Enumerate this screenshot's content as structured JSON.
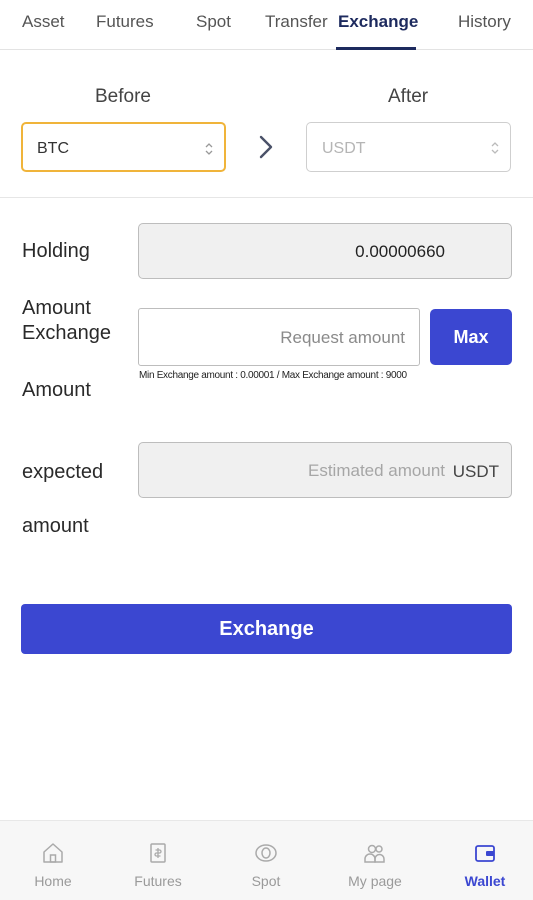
{
  "top_tabs": {
    "asset": "Asset",
    "futures": "Futures",
    "spot": "Spot",
    "transfer": "Transfer",
    "exchange": "Exchange",
    "history": "History",
    "active": "Exchange"
  },
  "swap": {
    "before_label": "Before",
    "after_label": "After",
    "before_value": "BTC",
    "after_value": "USDT"
  },
  "form": {
    "holding_label": "Holding",
    "holding_value": "0.00000660",
    "amount_exchange_label_line1": "Amount",
    "amount_exchange_label_line2": "Exchange",
    "amount_label": "Amount",
    "request_placeholder": "Request amount",
    "max_label": "Max",
    "limit_hint": "Min Exchange amount : 0.00001 / Max Exchange amount : 9000",
    "expected_label": "expected",
    "expected_amount_label": "amount",
    "estimated_placeholder": "Estimated amount",
    "estimated_unit": "USDT"
  },
  "exchange_button": "Exchange",
  "bottom_nav": {
    "home": "Home",
    "futures": "Futures",
    "spot": "Spot",
    "my_page": "My page",
    "wallet": "Wallet",
    "active": "Wallet"
  },
  "colors": {
    "accent": "#3b47d1",
    "selected_border": "#f0b43a",
    "tab_active": "#1d2a5e"
  }
}
